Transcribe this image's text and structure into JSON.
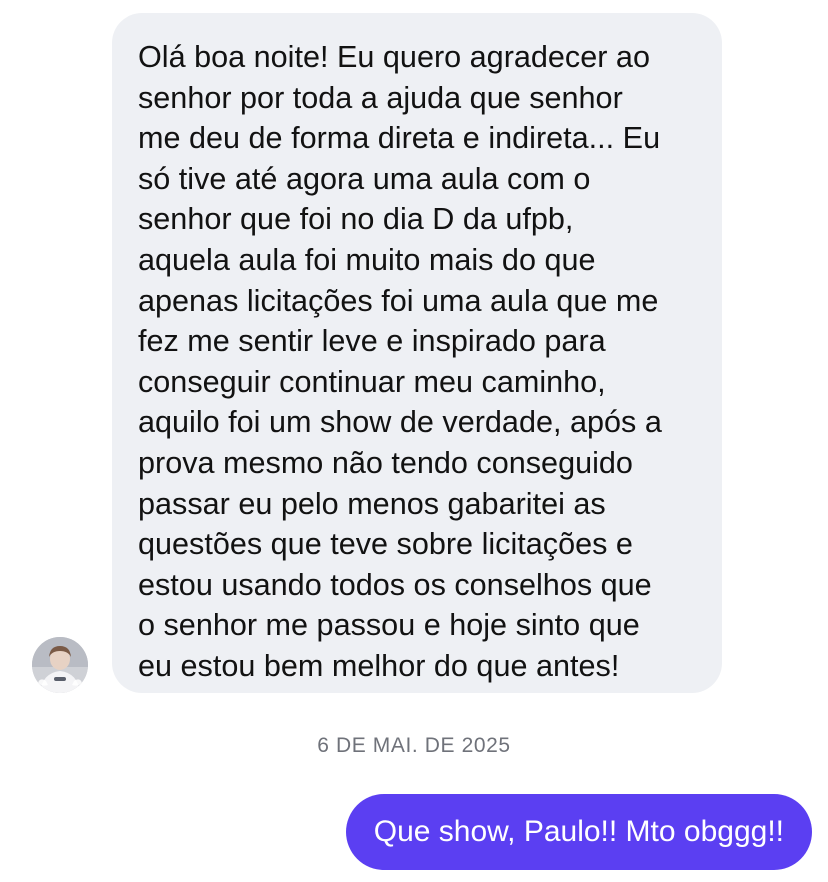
{
  "colors": {
    "incoming_bubble": "#eef0f4",
    "incoming_text": "#121212",
    "outgoing_bubble": "#5b3ff2",
    "outgoing_text": "#ffffff",
    "date_text": "#6f727a"
  },
  "incoming": {
    "avatar_icon": "profile-photo-avatar",
    "text": "Olá boa noite! Eu quero agradecer ao\nsenhor por toda a ajuda que senhor\nme deu de forma direta e indireta... Eu\nsó tive até agora uma aula com o\nsenhor que foi no dia D da ufpb,\naquela aula foi muito mais do que\napenas licitações foi uma aula que me\nfez me sentir leve e inspirado para\nconseguir continuar meu caminho,\naquilo foi um show de verdade, após a\nprova mesmo não tendo conseguido\npassar eu pelo menos gabaritei as\nquestões que teve sobre licitações e\nestou usando todos os conselhos que\no senhor me passou e hoje sinto que\neu estou bem melhor do que antes!"
  },
  "date_separator": "6 DE MAI. DE 2025",
  "outgoing": {
    "text": "Que show, Paulo!! Mto obggg!!"
  }
}
